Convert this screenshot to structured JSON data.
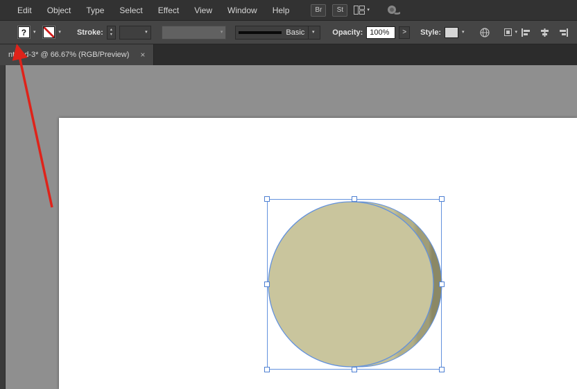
{
  "menubar": {
    "items": [
      "Edit",
      "Object",
      "Type",
      "Select",
      "Effect",
      "View",
      "Window",
      "Help"
    ],
    "bridge_button": "Br",
    "stock_button": "St"
  },
  "control_bar": {
    "fill_question": "?",
    "stroke_label": "Stroke:",
    "brush_name": "Basic",
    "opacity_label": "Opacity:",
    "opacity_value": "100%",
    "opacity_expand": ">",
    "style_label": "Style:"
  },
  "document_tab": {
    "title": "ntitled-3* @ 66.67% (RGB/Preview)",
    "close_label": "×"
  },
  "icons": {
    "chevron_down": "▾",
    "chevron_up": "▴"
  },
  "colors": {
    "selection_blue": "#6291dd",
    "handle_stroke": "#4d7fd2",
    "handle_fill": "#ffffff",
    "shape_fill": "#c9c59d",
    "extrude_light": "#c4c198",
    "extrude_band2": "#b2af87",
    "extrude_band3": "#a09d77",
    "extrude_dark": "#8b8865",
    "arrow_red": "#df231a"
  }
}
